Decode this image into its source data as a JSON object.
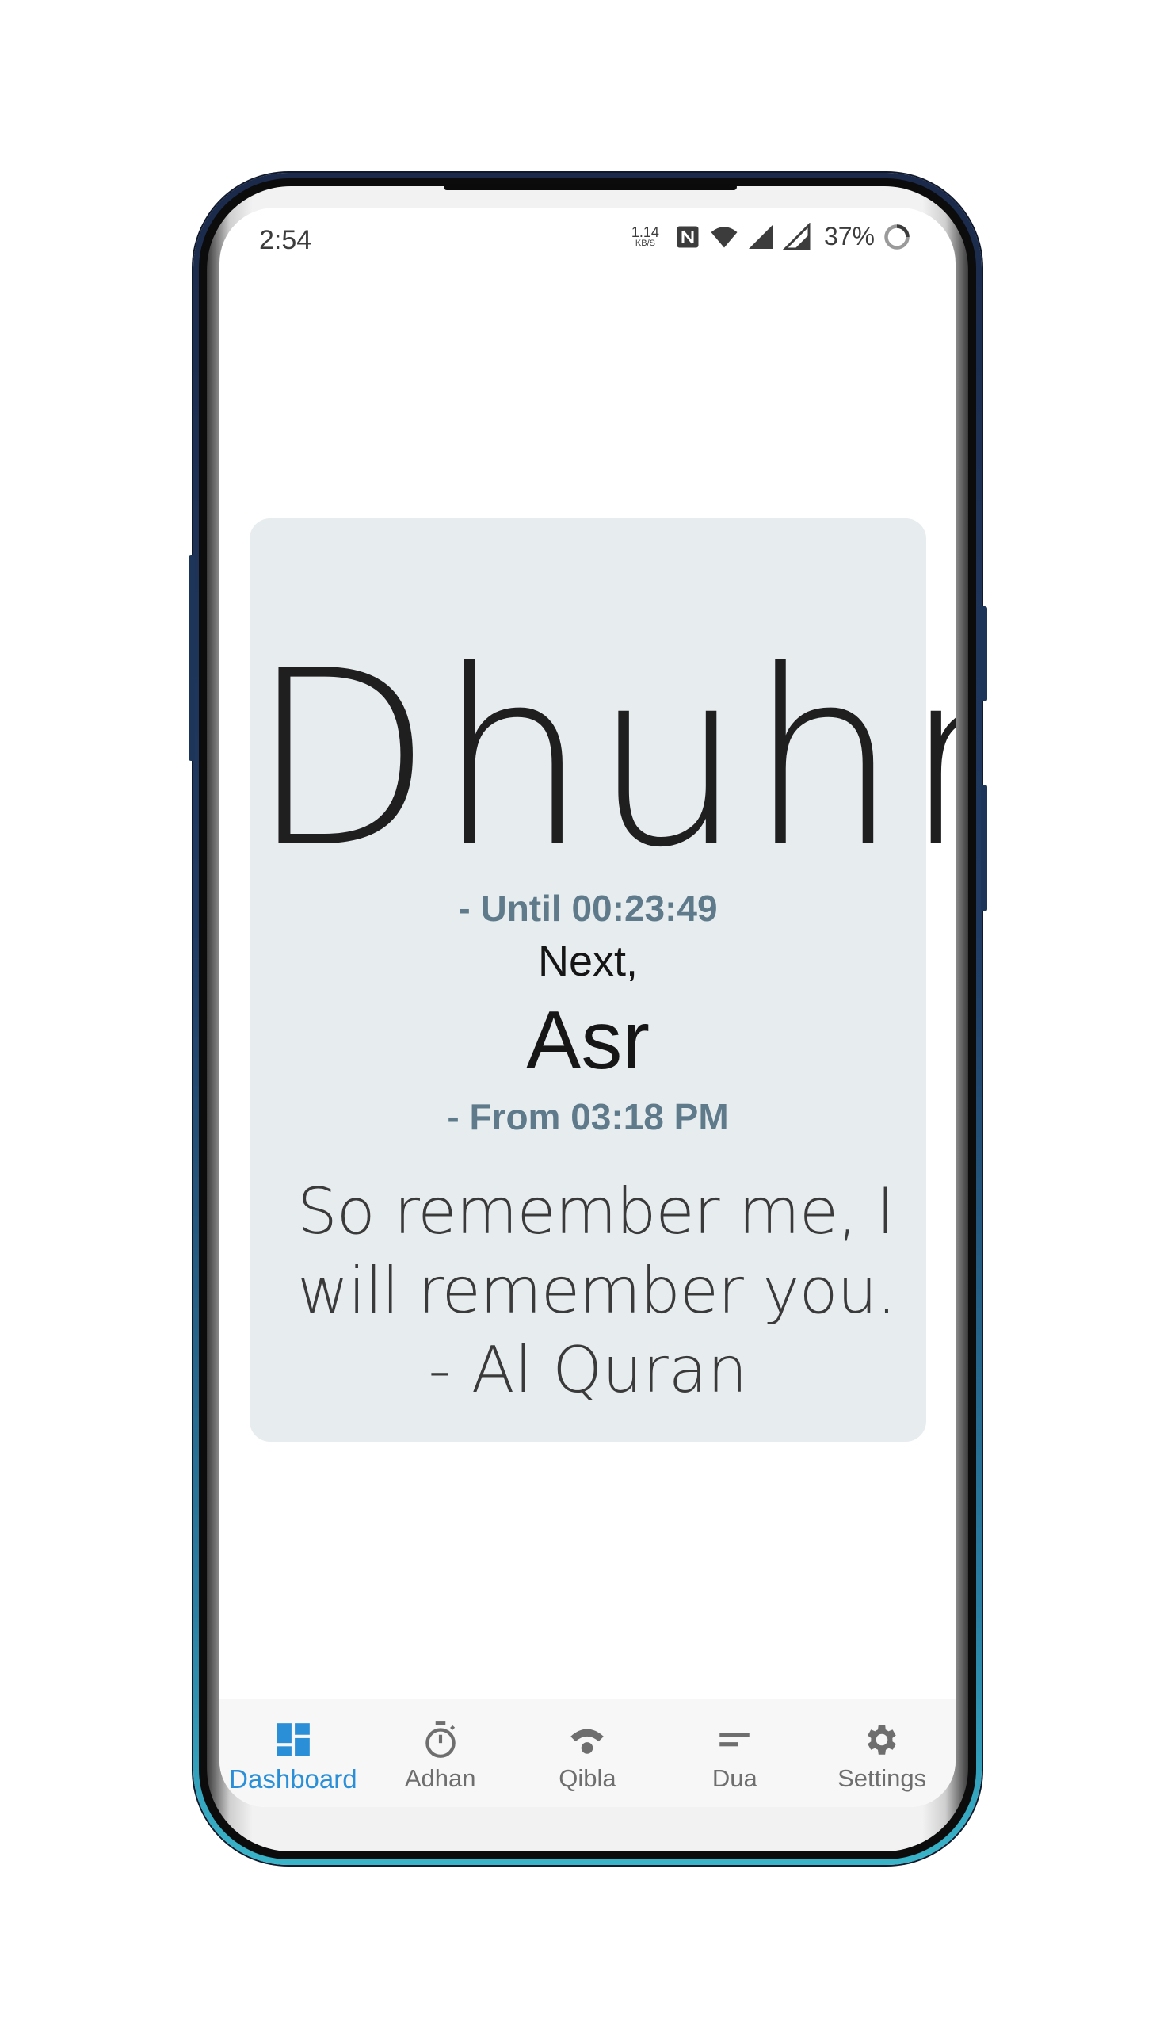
{
  "status_bar": {
    "time": "2:54",
    "net_speed_value": "1.14",
    "net_speed_unit": "KB/S",
    "battery_percent": "37%",
    "icons": [
      "nfc-icon",
      "wifi-icon",
      "cell-signal-icon",
      "cell-signal-icon",
      "battery-saver-icon"
    ]
  },
  "card": {
    "current_prayer": "Dhuhr",
    "until": "- Until 00:23:49",
    "next_label": "Next,",
    "next_prayer": "Asr",
    "from": "- From 03:18 PM",
    "quote_lines": [
      "So remember me, I",
      "will remember you.",
      "- Al Quran"
    ]
  },
  "nav": {
    "items": [
      {
        "label": "Dashboard",
        "icon": "dashboard-icon",
        "active": true
      },
      {
        "label": "Adhan",
        "icon": "timer-icon",
        "active": false
      },
      {
        "label": "Qibla",
        "icon": "qibla-icon",
        "active": false
      },
      {
        "label": "Dua",
        "icon": "dua-icon",
        "active": false
      },
      {
        "label": "Settings",
        "icon": "gear-icon",
        "active": false
      }
    ]
  },
  "colors": {
    "accent": "#2b8fd8",
    "card_bg": "#e7ecef",
    "time_text": "#5f7b8b",
    "nav_inactive": "#6e6e6e"
  }
}
